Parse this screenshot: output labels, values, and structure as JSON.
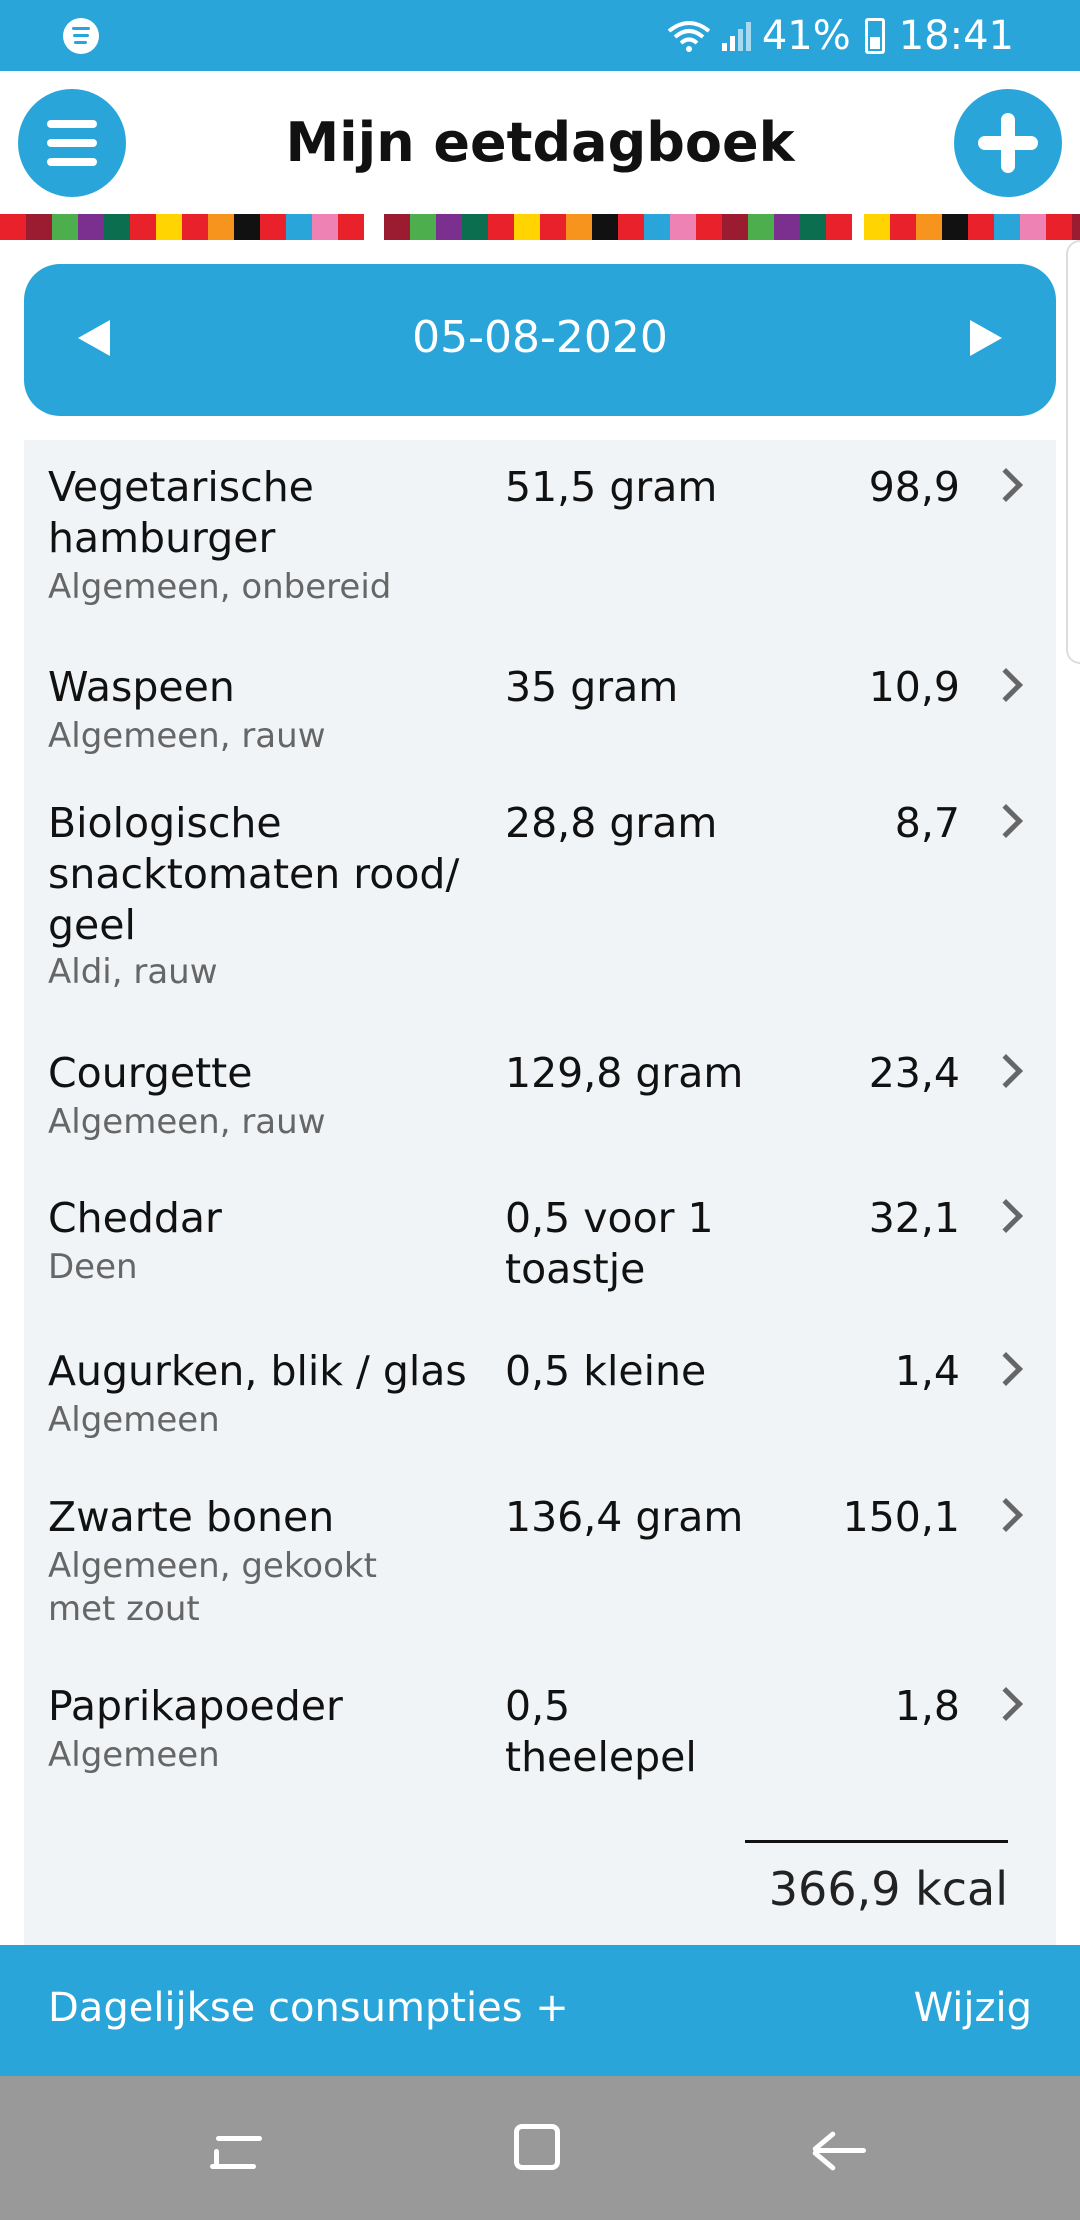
{
  "status_bar": {
    "battery": "41%",
    "time": "18:41"
  },
  "header": {
    "title": "Mijn eetdagboek"
  },
  "date_nav": {
    "date": "05-08-2020"
  },
  "items": [
    {
      "name_lines": [
        "Vegetarische",
        "hamburger"
      ],
      "sub_lines": [
        "Algemeen, onbereid"
      ],
      "qty_lines": [
        "51,5 gram"
      ],
      "kcal": "98,9"
    },
    {
      "name_lines": [
        "Waspeen"
      ],
      "sub_lines": [
        "Algemeen, rauw"
      ],
      "qty_lines": [
        "35 gram"
      ],
      "kcal": "10,9"
    },
    {
      "name_lines": [
        "Biologische",
        "snacktomaten rood/",
        "geel"
      ],
      "sub_lines": [
        "Aldi, rauw"
      ],
      "qty_lines": [
        "28,8 gram"
      ],
      "kcal": "8,7"
    },
    {
      "name_lines": [
        "Courgette"
      ],
      "sub_lines": [
        "Algemeen, rauw"
      ],
      "qty_lines": [
        "129,8 gram"
      ],
      "kcal": "23,4"
    },
    {
      "name_lines": [
        "Cheddar"
      ],
      "sub_lines": [
        "Deen"
      ],
      "qty_lines": [
        "0,5 voor 1",
        "toastje"
      ],
      "kcal": "32,1"
    },
    {
      "name_lines": [
        "Augurken, blik / glas"
      ],
      "sub_lines": [
        "Algemeen"
      ],
      "qty_lines": [
        "0,5 kleine"
      ],
      "kcal": "1,4"
    },
    {
      "name_lines": [
        "Zwarte bonen"
      ],
      "sub_lines": [
        "Algemeen, gekookt",
        "met zout"
      ],
      "qty_lines": [
        "136,4 gram"
      ],
      "kcal": "150,1"
    },
    {
      "name_lines": [
        "Paprikapoeder"
      ],
      "sub_lines": [
        "Algemeen"
      ],
      "qty_lines": [
        "0,5",
        "theelepel"
      ],
      "kcal": "1,8"
    }
  ],
  "total": "366,9 kcal",
  "footer": {
    "left_label": "Dagelijkse consumpties +",
    "right_label": "Wijzig"
  },
  "colors": {
    "accent": "#2aa5da",
    "list_background": "#f1f4f6",
    "nav_bar": "#999999"
  },
  "icons": [
    "spotify-icon",
    "wifi-icon",
    "signal-icon",
    "battery-icon",
    "menu-icon",
    "plus-icon",
    "arrow-left-icon",
    "arrow-right-icon",
    "chevron-right-icon",
    "nav-recent-icon",
    "nav-home-icon",
    "nav-back-icon"
  ]
}
